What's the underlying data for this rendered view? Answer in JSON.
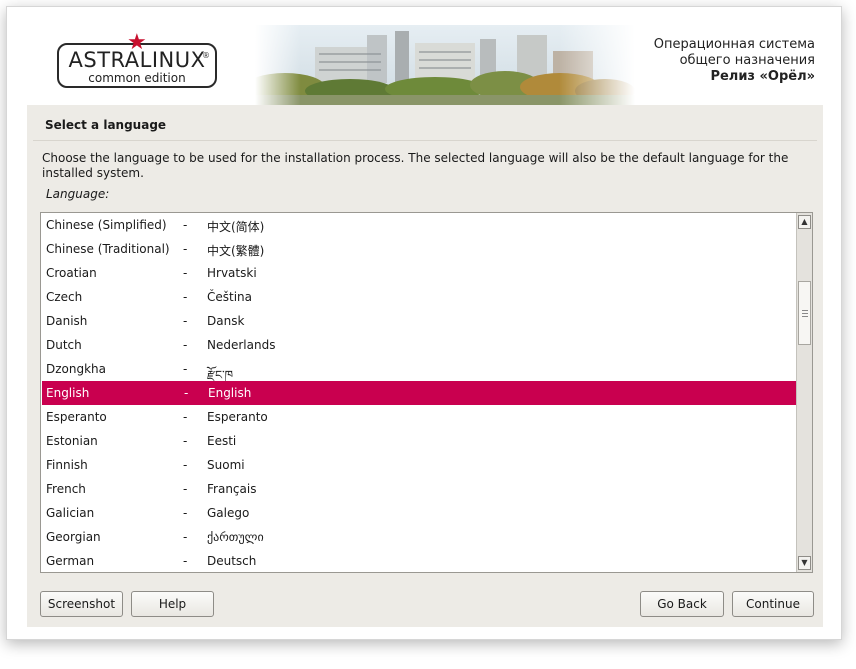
{
  "header": {
    "logo": {
      "brand": "ASTRALINUX",
      "registered": "®",
      "edition": "common edition",
      "star_color": "#c8102e"
    },
    "release": {
      "line1": "Операционная система",
      "line2": "общего назначения",
      "line3": "Релиз «Орёл»"
    }
  },
  "installer": {
    "title": "Select a language",
    "description": "Choose the language to be used for the installation process. The selected language will also be the default language for the installed system.",
    "field_label": "Language:",
    "selected_index": 7,
    "selection_color": "#c9004f",
    "languages": [
      {
        "name": "Chinese (Simplified)",
        "sep": "-",
        "native": "中文(简体)"
      },
      {
        "name": "Chinese (Traditional)",
        "sep": "-",
        "native": "中文(繁體)"
      },
      {
        "name": "Croatian",
        "sep": "-",
        "native": "Hrvatski"
      },
      {
        "name": "Czech",
        "sep": "-",
        "native": "Čeština"
      },
      {
        "name": "Danish",
        "sep": "-",
        "native": "Dansk"
      },
      {
        "name": "Dutch",
        "sep": "-",
        "native": "Nederlands"
      },
      {
        "name": "Dzongkha",
        "sep": "-",
        "native": "རྫོང་ཁ"
      },
      {
        "name": "English",
        "sep": "-",
        "native": "English"
      },
      {
        "name": "Esperanto",
        "sep": "-",
        "native": "Esperanto"
      },
      {
        "name": "Estonian",
        "sep": "-",
        "native": "Eesti"
      },
      {
        "name": "Finnish",
        "sep": "-",
        "native": "Suomi"
      },
      {
        "name": "French",
        "sep": "-",
        "native": "Français"
      },
      {
        "name": "Galician",
        "sep": "-",
        "native": "Galego"
      },
      {
        "name": "Georgian",
        "sep": "-",
        "native": "ქართული"
      },
      {
        "name": "German",
        "sep": "-",
        "native": "Deutsch"
      }
    ],
    "scrollbar": {
      "up_icon": "arrow-up-icon",
      "down_icon": "arrow-down-icon"
    }
  },
  "buttons": {
    "screenshot": "Screenshot",
    "help": "Help",
    "go_back": "Go Back",
    "continue": "Continue"
  }
}
